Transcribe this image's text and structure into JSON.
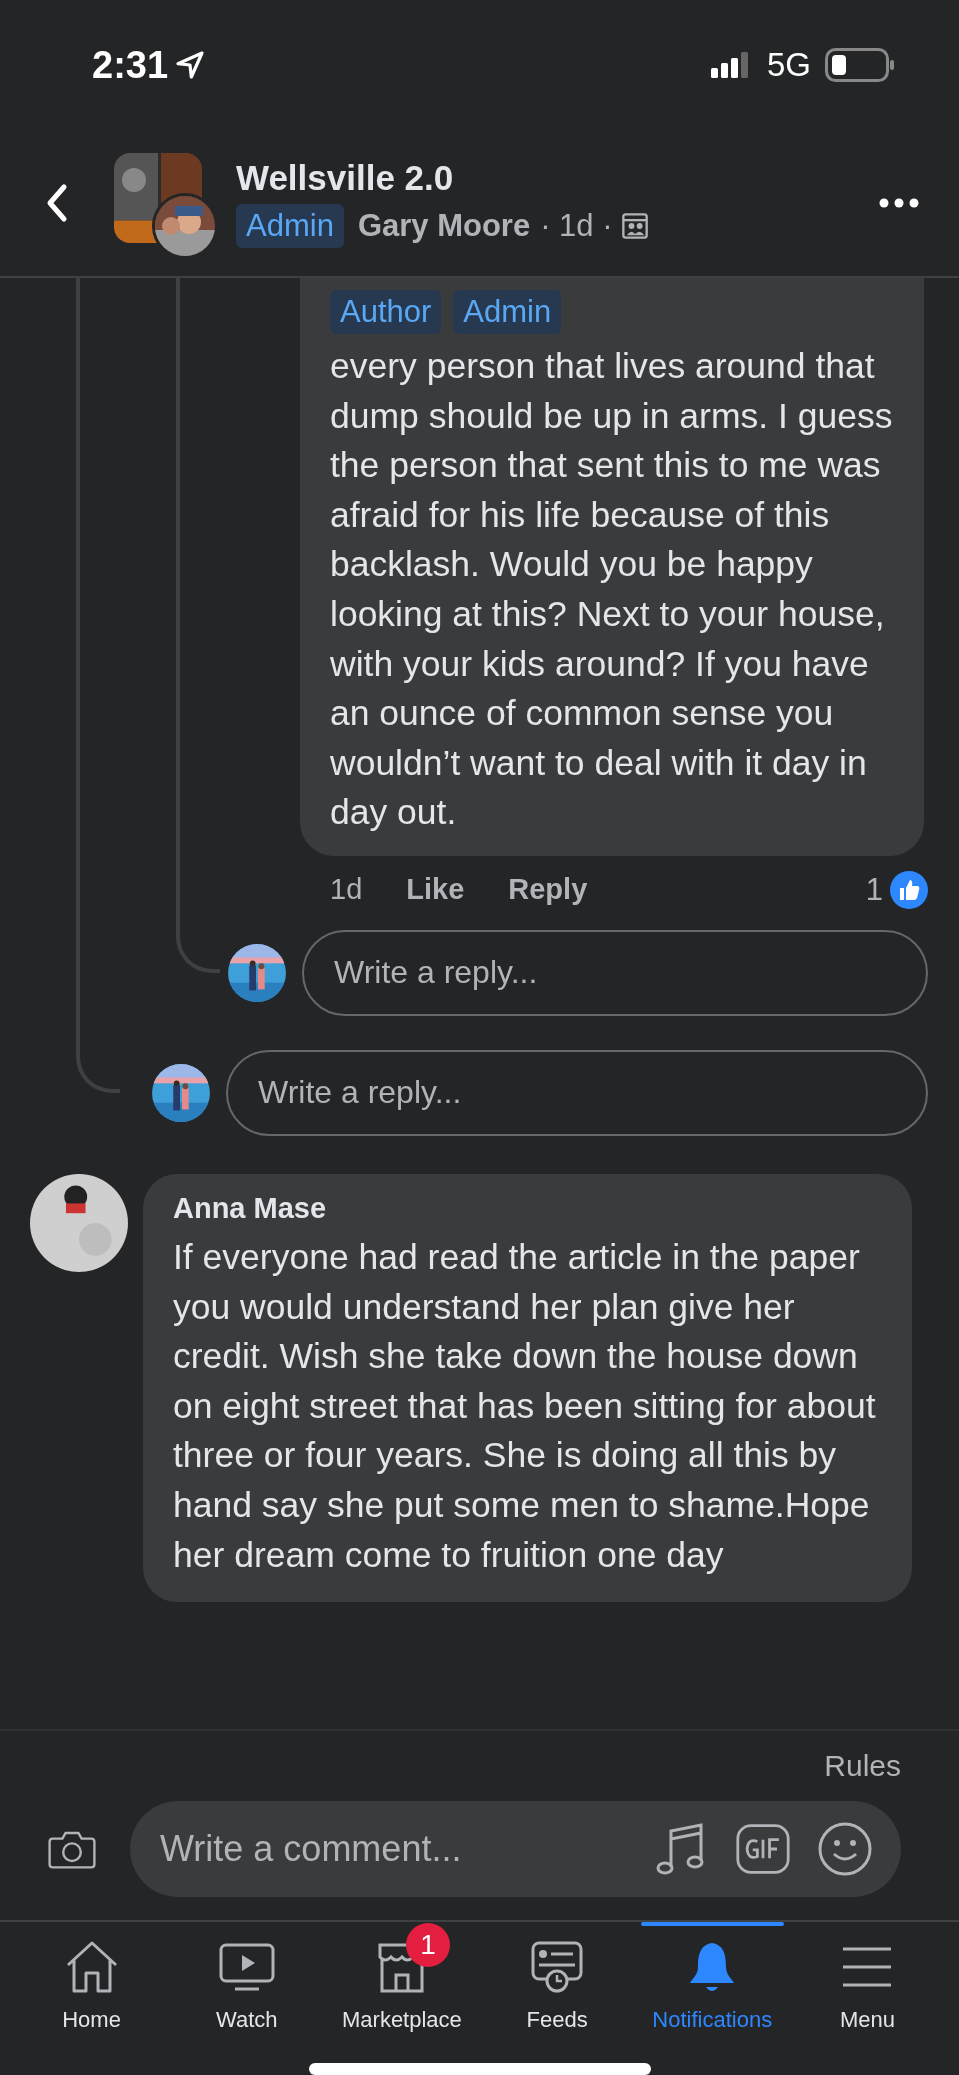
{
  "status_bar": {
    "time": "2:31",
    "network": "5G"
  },
  "header": {
    "title": "Wellsville 2.0",
    "badge": "Admin",
    "author": "Gary Moore",
    "meta": "· 1d ·"
  },
  "reply": {
    "tags": [
      "Author",
      "Admin"
    ],
    "text": "every person that lives around that dump should be up in arms. I guess the person that sent this to me was afraid for his life because of this backlash. Would you be happy looking at this? Next to your house, with your kids around? If you have an ounce of common sense you wouldn’t want to deal with it day in day out.",
    "time": "1d",
    "actions": [
      "Like",
      "Reply"
    ],
    "reactions": "1"
  },
  "reply_fields": [
    {
      "placeholder": "Write a reply..."
    },
    {
      "placeholder": "Write a reply..."
    }
  ],
  "comment": {
    "author": "Anna Mase",
    "text": "If everyone had read the article in the paper you would understand her plan give her credit.  Wish she take down the house down on eight street  that has been sitting for about three or four years.  She is doing all this by hand say she put some men to shame.Hope her dream come  to fruition one day"
  },
  "rules_link": "Rules",
  "comment_field": {
    "placeholder": "Write a comment..."
  },
  "tab_bar": [
    {
      "kind": "home",
      "label": "Home",
      "selected": false
    },
    {
      "kind": "watch",
      "label": "Watch",
      "selected": false
    },
    {
      "kind": "marketplace",
      "label": "Marketplace",
      "selected": false,
      "badge": "1"
    },
    {
      "kind": "feeds",
      "label": "Feeds",
      "selected": false
    },
    {
      "kind": "notifications",
      "label": "Notifications",
      "selected": true
    },
    {
      "kind": "menu",
      "label": "Menu",
      "selected": false
    }
  ]
}
